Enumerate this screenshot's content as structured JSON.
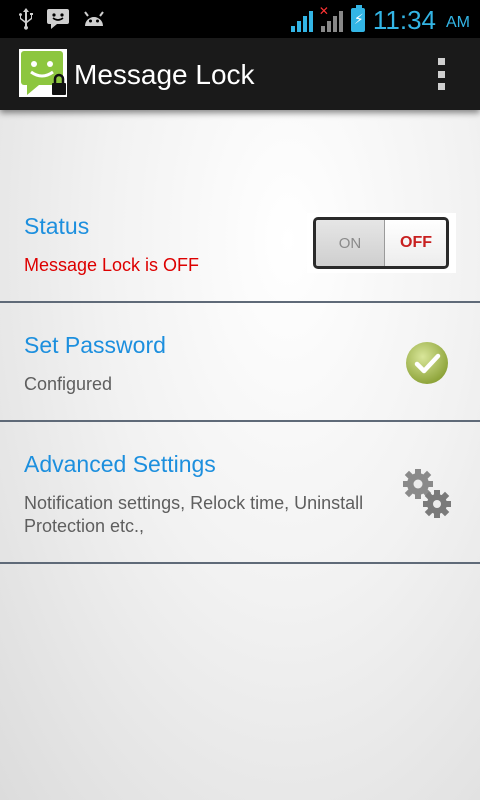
{
  "status_bar": {
    "time": "11:34",
    "ampm": "AM",
    "icons": [
      "usb-icon",
      "message-notification-icon",
      "android-debug-icon",
      "wifi-signal-icon",
      "no-signal-icon",
      "battery-charging-icon"
    ]
  },
  "action_bar": {
    "title": "Message Lock",
    "app_icon": "message-lock-app-icon",
    "overflow_icon": "overflow-menu-icon"
  },
  "settings": {
    "status": {
      "title": "Status",
      "subtitle": "Message Lock is OFF",
      "subtitle_color": "#dd0000",
      "toggle": {
        "on_label": "ON",
        "off_label": "OFF",
        "state": "OFF"
      }
    },
    "password": {
      "title": "Set Password",
      "subtitle": "Configured",
      "icon": "checkmark-icon"
    },
    "advanced": {
      "title": "Advanced Settings",
      "subtitle": "Notification settings, Relock time, Uninstall Protection etc.,",
      "icon": "gears-icon"
    }
  },
  "colors": {
    "accent": "#1c8fde",
    "status_blue": "#33b5e5",
    "action_bar": "#1a1a1a"
  }
}
